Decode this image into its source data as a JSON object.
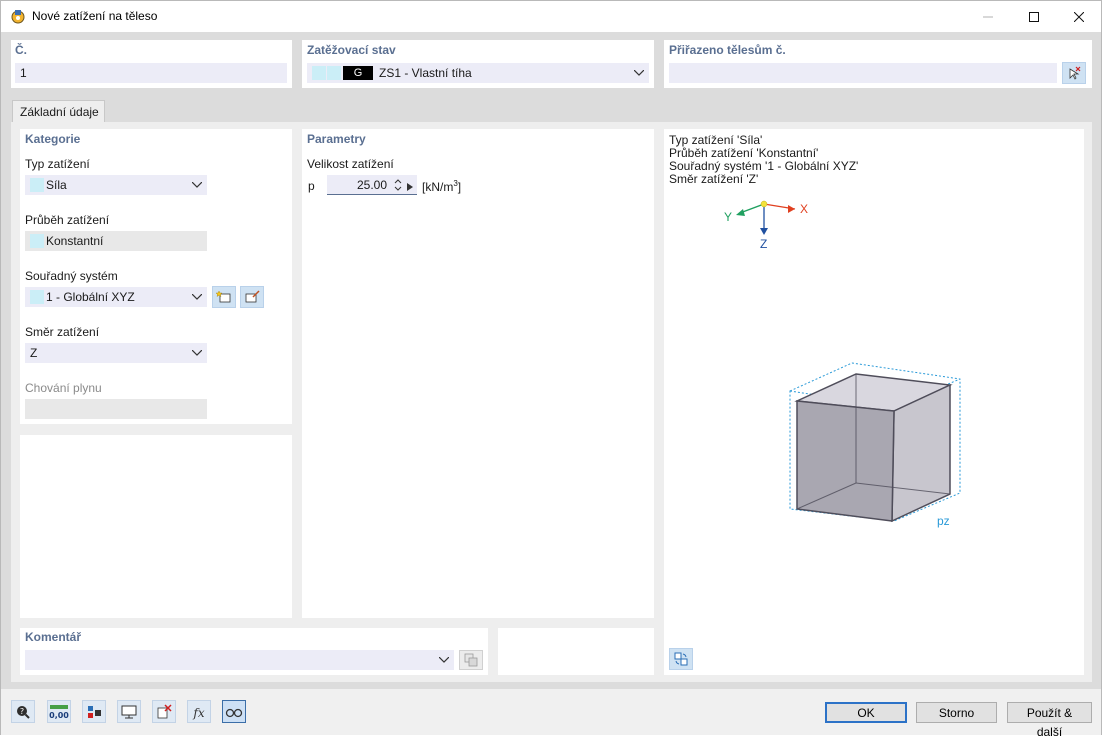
{
  "window": {
    "title": "Nové zatížení na těleso"
  },
  "header": {
    "number": {
      "label": "Č.",
      "value": "1"
    },
    "load_case": {
      "label": "Zatěžovací stav",
      "badge": "G",
      "value": "ZS1 - Vlastní tíha"
    },
    "assigned": {
      "label": "Přiřazeno tělesům č.",
      "value": ""
    }
  },
  "tabs": [
    {
      "label": "Základní údaje"
    }
  ],
  "category": {
    "title": "Kategorie",
    "load_type": {
      "label": "Typ zatížení",
      "value": "Síla"
    },
    "distribution": {
      "label": "Průběh zatížení",
      "value": "Konstantní"
    },
    "coord_system": {
      "label": "Souřadný systém",
      "value": "1 - Globální XYZ"
    },
    "direction": {
      "label": "Směr zatížení",
      "value": "Z"
    },
    "gas_behavior": {
      "label": "Chování plynu",
      "value": ""
    }
  },
  "parameters": {
    "title": "Parametry",
    "magnitude_label": "Velikost zatížení",
    "symbol": "p",
    "value": "25.00",
    "unit_base": "[kN/m",
    "unit_exp": "3",
    "unit_end": "]"
  },
  "preview": {
    "lines": [
      "Typ zatížení 'Síla'",
      "Průběh zatížení 'Konstantní'",
      "Souřadný systém '1 - Globální XYZ'",
      "Směr zatížení 'Z'"
    ],
    "axis_x": "X",
    "axis_y": "Y",
    "axis_z": "Z",
    "load_label": "pz"
  },
  "comment": {
    "label": "Komentář",
    "value": ""
  },
  "buttons": {
    "ok": "OK",
    "cancel": "Storno",
    "apply_next": "Použít & další"
  },
  "colors": {
    "accent": "#5a6f91",
    "swatch": "#cbeef7",
    "axis_x": "#e04020",
    "axis_y": "#20a060",
    "axis_z": "#2050a0",
    "load_label": "#2a9ad8"
  }
}
